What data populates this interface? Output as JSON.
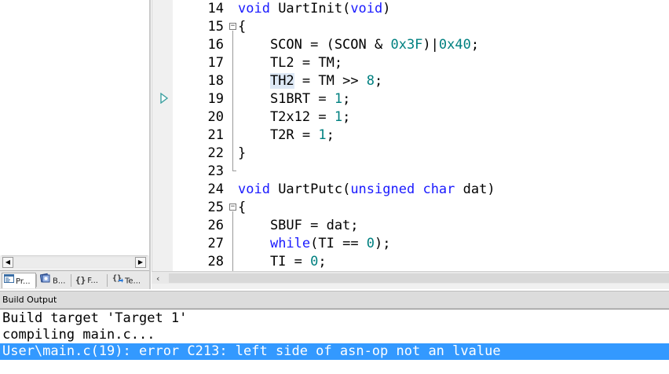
{
  "project_panel": {
    "tabs": [
      {
        "label": "Pr...",
        "icon": "project-icon"
      },
      {
        "label": "B...",
        "icon": "books-icon"
      },
      {
        "label": "F...",
        "icon": "functions-icon"
      },
      {
        "label": "Te...",
        "icon": "templates-icon"
      }
    ]
  },
  "editor": {
    "line_numbers": [
      "14",
      "15",
      "16",
      "17",
      "18",
      "19",
      "20",
      "21",
      "22",
      "23",
      "24",
      "25",
      "26",
      "27",
      "28"
    ],
    "lines": [
      "void UartInit(void)",
      "{",
      "    SCON = (SCON & 0x3F)|0x40;",
      "    TL2 = TM;",
      "    TH2 = TM >> 8;",
      "    S1BRT = 1;",
      "    T2x12 = 1;",
      "    T2R = 1;",
      "}",
      "",
      "void UartPutc(unsigned char dat)",
      "{",
      "    SBUF = dat;",
      "    while(TI == 0);",
      "    TI = 0;"
    ],
    "keyword_color": "#1a1aff",
    "number_color": "#008080",
    "execution_arrow_color": "#3ca0a0"
  },
  "build_output": {
    "title": "Build Output",
    "lines": [
      "Build target 'Target 1'",
      "compiling main.c...",
      "User\\main.c(19): error C213: left side of asn-op not an lvalue"
    ],
    "selected_color": "#3399ff"
  }
}
